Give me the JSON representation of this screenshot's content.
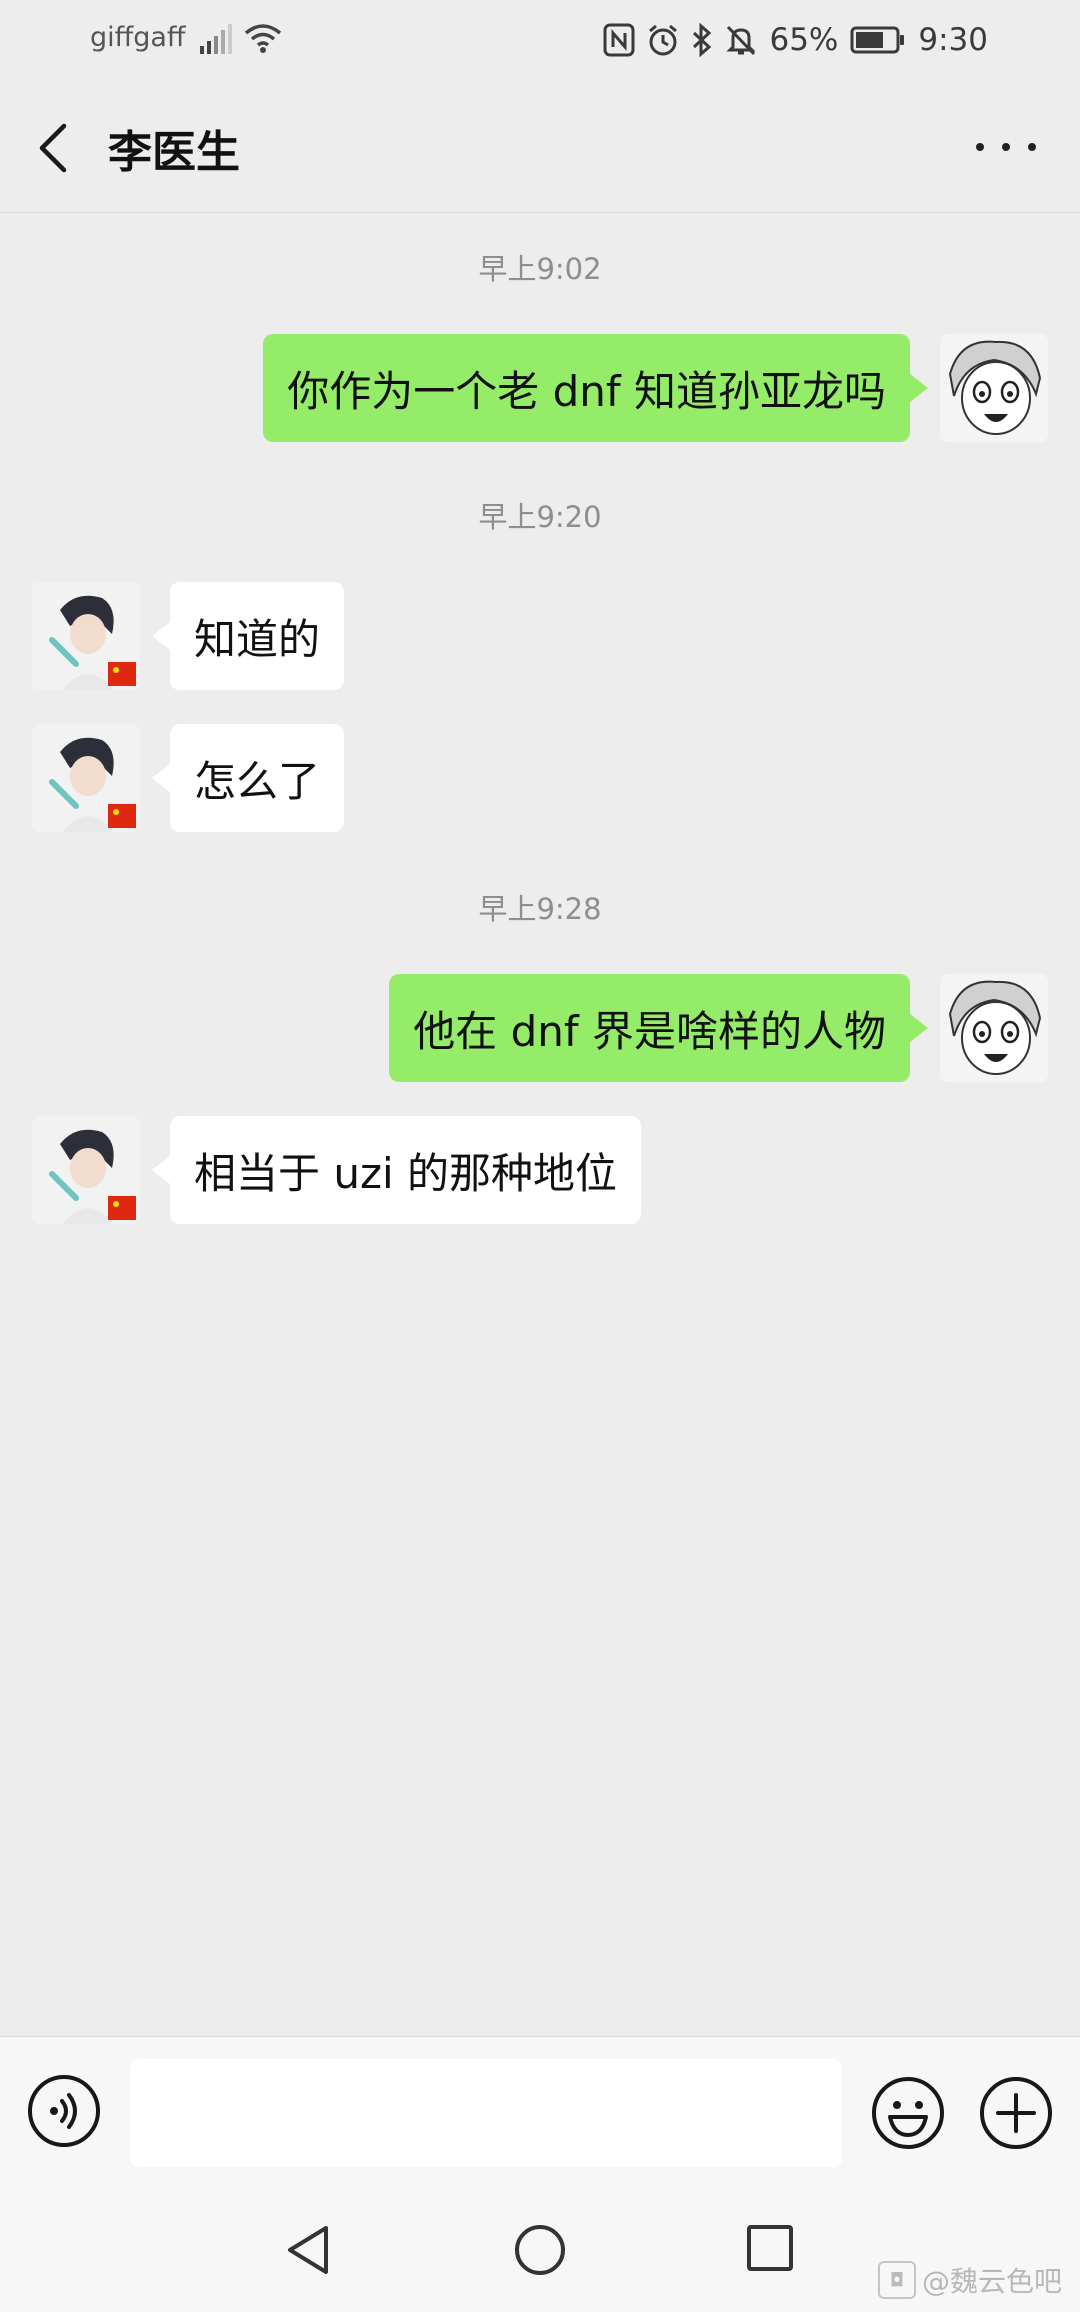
{
  "status_bar": {
    "carrier": "giffgaff",
    "battery": "65%",
    "time": "9:30",
    "icons": [
      "signal-icon",
      "wifi-icon",
      "nfc-icon",
      "alarm-icon",
      "bluetooth-icon",
      "mute-icon",
      "battery-icon"
    ]
  },
  "header": {
    "title": "李医生",
    "back_icon": "chevron-left-icon",
    "more_icon": "more-dots-icon"
  },
  "messages": [
    {
      "type": "timestamp",
      "text": "早上9:02"
    },
    {
      "type": "message",
      "side": "right",
      "text": "你作为一个老 dnf 知道孙亚龙吗"
    },
    {
      "type": "timestamp",
      "text": "早上9:20"
    },
    {
      "type": "message",
      "side": "left",
      "text": "知道的"
    },
    {
      "type": "message",
      "side": "left",
      "text": "怎么了"
    },
    {
      "type": "timestamp",
      "text": "早上9:28"
    },
    {
      "type": "message",
      "side": "right",
      "text": "他在 dnf 界是啥样的人物"
    },
    {
      "type": "message",
      "side": "left",
      "text": "相当于 uzi 的那种地位"
    }
  ],
  "input_bar": {
    "value": "",
    "icons": [
      "voice-icon",
      "emoji-icon",
      "plus-icon"
    ]
  },
  "nav_bar": {
    "icons": [
      "nav-back-icon",
      "nav-home-icon",
      "nav-recent-icon"
    ]
  },
  "watermark": "@魏云色吧",
  "colors": {
    "background": "#ededed",
    "outgoing_bubble": "#95ec69",
    "incoming_bubble": "#ffffff",
    "timestamp": "#8e8e8e"
  }
}
